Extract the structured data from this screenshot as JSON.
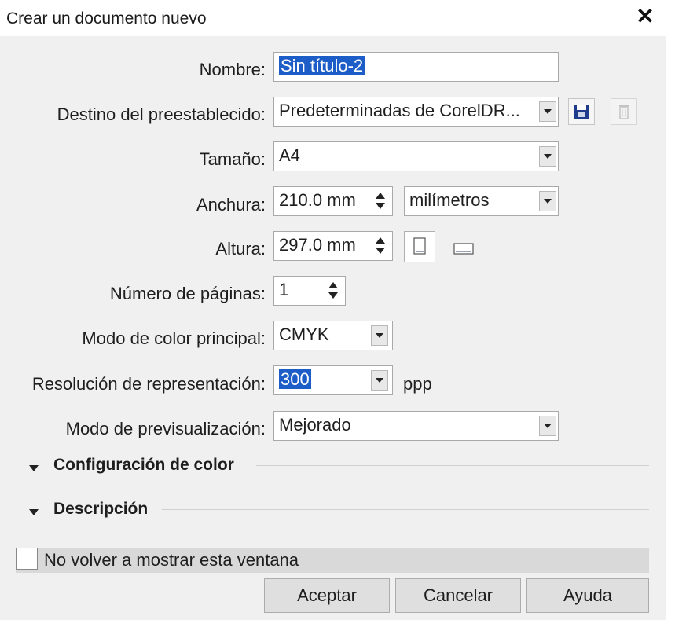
{
  "window": {
    "title": "Crear un documento nuevo",
    "close_glyph": "✕"
  },
  "form": {
    "name_label": "Nombre:",
    "name_value": "Sin título-2",
    "preset_label": "Destino del preestablecido:",
    "preset_value": "Predeterminadas de CorelDR...",
    "size_label": "Tamaño:",
    "size_value": "A4",
    "width_label": "Anchura:",
    "width_value": "210.0 mm",
    "units_value": "milímetros",
    "height_label": "Altura:",
    "height_value": "297.0 mm",
    "pages_label": "Número de páginas:",
    "pages_value": "1",
    "color_mode_label": "Modo de color principal:",
    "color_mode_value": "CMYK",
    "resolution_label": "Resolución de representación:",
    "resolution_value": "300",
    "resolution_unit": "ppp",
    "preview_label": "Modo de previsualización:",
    "preview_value": "Mejorado"
  },
  "sections": {
    "color_settings": "Configuración de color",
    "description": "Descripción"
  },
  "footer": {
    "dont_show_label": "No volver a mostrar esta ventana",
    "dont_show_checked": false,
    "accept": "Aceptar",
    "cancel": "Cancelar",
    "help": "Ayuda"
  },
  "colors": {
    "selection": "#1c5dc7",
    "dialog_bg": "#f0f0f0",
    "save_icon": "#1f3b8c"
  },
  "icons": [
    "close-icon",
    "save-icon",
    "delete-icon",
    "portrait-icon",
    "landscape-icon",
    "dropdown-arrow-icon",
    "spinner-icon",
    "expand-triangle-icon"
  ]
}
